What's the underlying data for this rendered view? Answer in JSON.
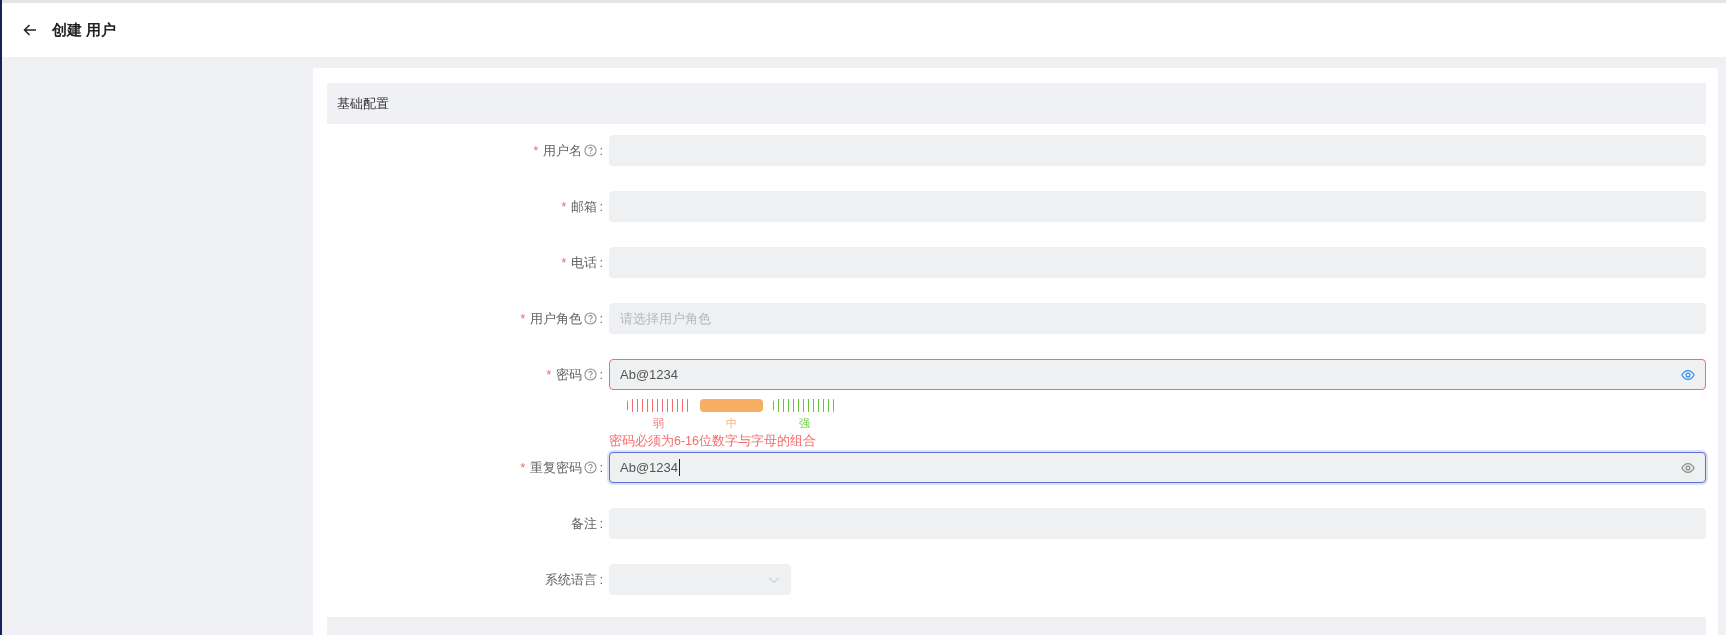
{
  "header": {
    "title": "创建 用户"
  },
  "section": {
    "title": "基础配置"
  },
  "fields": [
    {
      "kind": "text",
      "mark": "*",
      "label": "用户名",
      "help": true,
      "colon": ":"
    },
    {
      "kind": "text",
      "mark": "*",
      "label": "邮箱",
      "help": false,
      "colon": ":"
    },
    {
      "kind": "text",
      "mark": "*",
      "label": "电话",
      "help": false,
      "colon": ":"
    },
    {
      "kind": "select",
      "mark": "*",
      "label": "用户角色",
      "help": true,
      "colon": ":",
      "placeholder": "请选择用户角色",
      "wide": true
    },
    {
      "kind": "password",
      "mark": "*",
      "label": "密码",
      "help": true,
      "colon": ":",
      "value": "Ab@1234",
      "invalid": true,
      "focused": false,
      "eye_active": true,
      "strength": [
        {
          "label": "弱",
          "selected": false,
          "color": "#f56c6c"
        },
        {
          "label": "中",
          "selected": true,
          "color": "#f7ae62"
        },
        {
          "label": "强",
          "selected": false,
          "color": "#67c23a"
        }
      ],
      "error": "密码必须为6-16位数字与字母的组合"
    },
    {
      "kind": "password",
      "mark": "*",
      "label": "重复密码",
      "help": true,
      "colon": ":",
      "value": "Ab@1234",
      "invalid": false,
      "focused": true,
      "eye_active": false
    },
    {
      "kind": "text",
      "label": "备注",
      "help": false,
      "colon": ":"
    },
    {
      "kind": "select",
      "label": "系统语言",
      "help": false,
      "colon": ":",
      "wide": false
    }
  ]
}
